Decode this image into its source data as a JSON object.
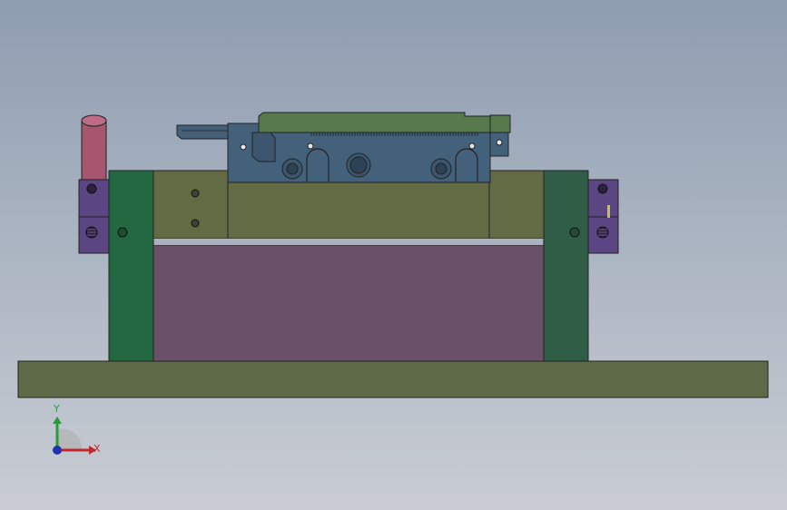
{
  "viewport": {
    "background_top": "#8f9db1",
    "background_bottom": "#c9cdd3"
  },
  "model": {
    "parts": [
      {
        "name": "base-plate",
        "color": "#5f6b48"
      },
      {
        "name": "left-support-column",
        "color": "#236840"
      },
      {
        "name": "right-support-column",
        "color": "#2f5d46"
      },
      {
        "name": "center-block",
        "color": "#6a5069"
      },
      {
        "name": "cross-beam",
        "color": "#626b44"
      },
      {
        "name": "fixture-plate",
        "color": "#43617b"
      },
      {
        "name": "top-cover",
        "color": "#577a4d"
      },
      {
        "name": "side-clamp",
        "color": "#5b4582"
      },
      {
        "name": "cylinder-rod",
        "color": "#a6566e"
      },
      {
        "name": "tongue-slide",
        "color": "#46607a"
      }
    ]
  },
  "triad": {
    "x_label": "X",
    "y_label": "Y",
    "x_color": "#c0282d",
    "y_color": "#2a9a3a",
    "z_color": "#2233b0"
  }
}
